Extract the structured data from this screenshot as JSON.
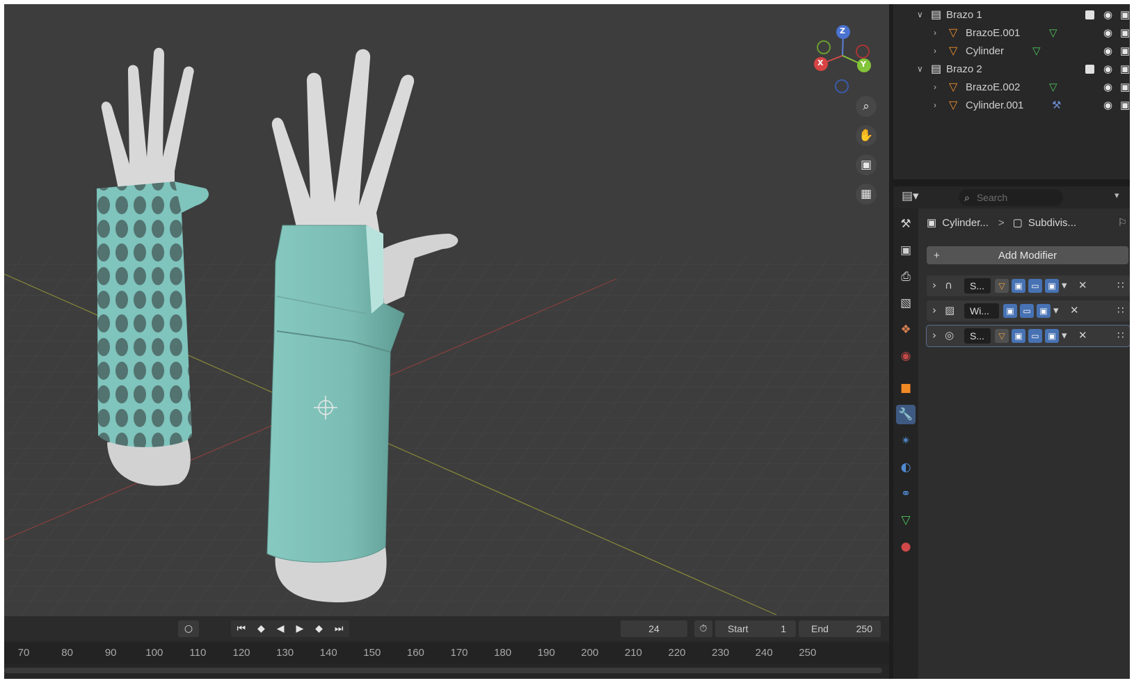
{
  "outliner": {
    "rows": [
      {
        "type": "collection",
        "label": "Brazo 1"
      },
      {
        "type": "object",
        "label": "BrazoE.001",
        "extra_icon": "mesh-data-icon"
      },
      {
        "type": "object",
        "label": "Cylinder",
        "extra_icon": "mesh-data-icon"
      },
      {
        "type": "collection",
        "label": "Brazo 2"
      },
      {
        "type": "object",
        "label": "BrazoE.002",
        "extra_icon": "mesh-data-icon"
      },
      {
        "type": "object",
        "label": "Cylinder.001",
        "extra_icon": "modifier-wrench-icon"
      }
    ]
  },
  "properties": {
    "search_placeholder": "Search",
    "breadcrumb": {
      "object": "Cylinder...",
      "separator": ">",
      "modifier": "Subdivis..."
    },
    "add_modifier_label": "Add Modifier",
    "add_icon": "+",
    "modifiers": [
      {
        "name": "S...",
        "icon": "subdivision-icon",
        "selected": false
      },
      {
        "name": "Wi...",
        "icon": "wireframe-icon",
        "selected": false
      },
      {
        "name": "S...",
        "icon": "smooth-icon",
        "selected": true
      }
    ]
  },
  "timeline": {
    "current_frame": "24",
    "start_label": "Start",
    "start_value": "1",
    "end_label": "End",
    "end_value": "250",
    "ruler": [
      "70",
      "80",
      "90",
      "100",
      "110",
      "120",
      "130",
      "140",
      "150",
      "160",
      "170",
      "180",
      "190",
      "200",
      "210",
      "220",
      "230",
      "240",
      "250"
    ]
  },
  "gizmo": {
    "x": "X",
    "y": "Y",
    "z": "Z"
  },
  "colors": {
    "cast": "#7fc4bd",
    "skin": "#d8d8d8",
    "active_tab": "#3f5a82",
    "accent_blue": "#4772b3"
  }
}
